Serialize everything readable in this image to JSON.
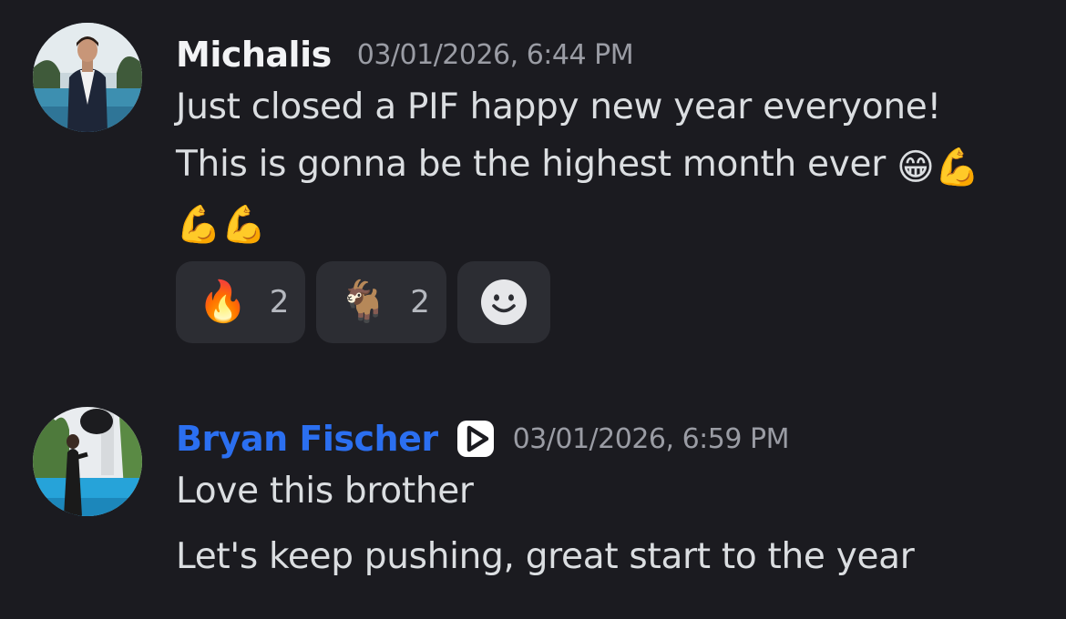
{
  "messages": [
    {
      "username": "Michalis",
      "timestamp": "03/01/2026, 6:44 PM",
      "avatar_icon": "user-avatar-photo",
      "lines": [
        "Just closed a PIF happy new year everyone!",
        "This is gonna be the highest month ever"
      ],
      "line2_emojis": "😁💪",
      "line3_emojis": "💪💪",
      "reactions": [
        {
          "emoji": "🔥",
          "count": "2"
        },
        {
          "emoji": "🐐",
          "count": "2"
        }
      ],
      "add_reaction_icon": "smiley-add-reaction-icon"
    },
    {
      "username": "Bryan Fischer",
      "username_color": "#2b6ff0",
      "badge_icon": "play-badge-icon",
      "timestamp": "03/01/2026, 6:59 PM",
      "avatar_icon": "user-avatar-photo",
      "lines": [
        "Love this brother",
        "Let's keep pushing, great start to the year"
      ]
    }
  ]
}
